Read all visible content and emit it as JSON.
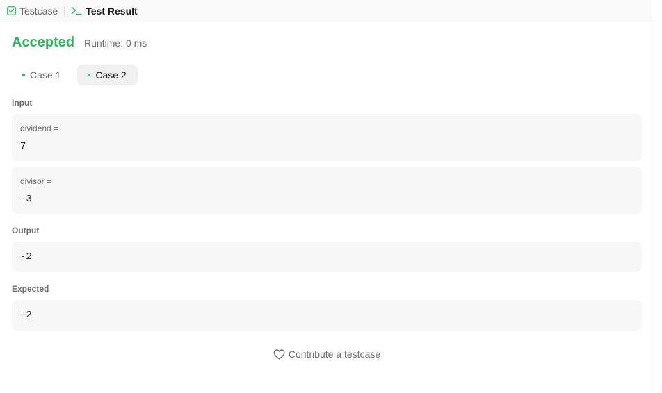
{
  "tabs": [
    {
      "label": "Testcase",
      "icon": "checkbox-icon"
    },
    {
      "label": "Test Result",
      "icon": "terminal-icon"
    }
  ],
  "result": {
    "status": "Accepted",
    "runtime": "Runtime: 0 ms"
  },
  "cases": [
    {
      "label": "Case 1",
      "active": false
    },
    {
      "label": "Case 2",
      "active": true
    }
  ],
  "input": {
    "label": "Input",
    "params": [
      {
        "name": "dividend =",
        "value": "7"
      },
      {
        "name": "divisor =",
        "value": "-3"
      }
    ]
  },
  "output": {
    "label": "Output",
    "value": "-2"
  },
  "expected": {
    "label": "Expected",
    "value": "-2"
  },
  "contribute_label": "Contribute a testcase",
  "colors": {
    "accepted": "#2db55d",
    "box_bg": "#f7f7f8",
    "active_case_bg": "#f0f0f0"
  }
}
